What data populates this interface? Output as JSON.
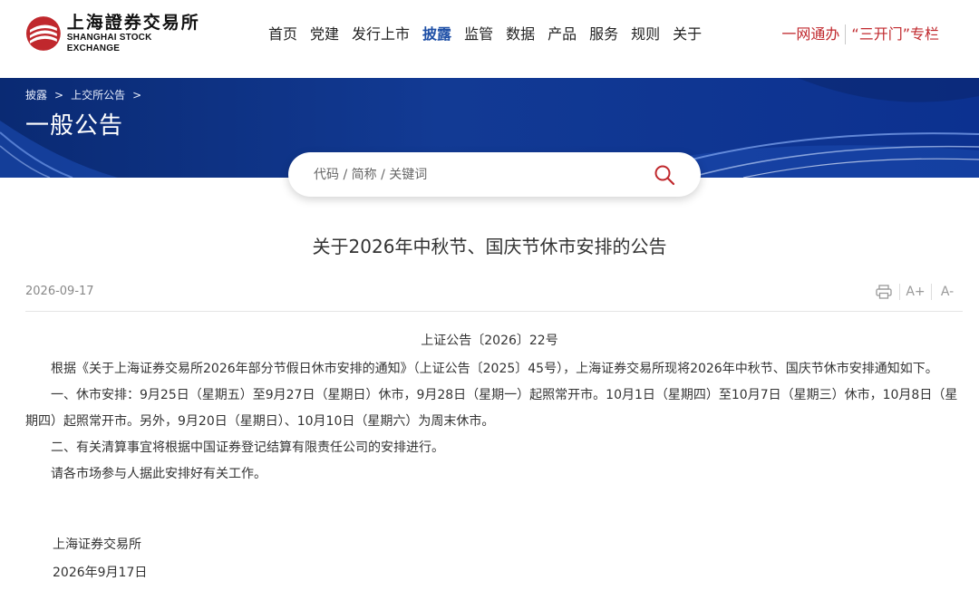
{
  "header": {
    "logo_cn": "上海證券交易所",
    "logo_en": "SHANGHAI STOCK EXCHANGE",
    "nav": [
      "首页",
      "党建",
      "发行上市",
      "披露",
      "监管",
      "数据",
      "产品",
      "服务",
      "规则",
      "关于"
    ],
    "active_nav": "披露",
    "links": [
      "一网通办",
      "“三开门”专栏"
    ],
    "accent_color": "#c0282d"
  },
  "banner": {
    "breadcrumb": [
      "披露",
      "上交所公告"
    ],
    "title": "一般公告"
  },
  "search": {
    "placeholder": "代码 / 简称 / 关键词"
  },
  "article": {
    "title": "关于2026年中秋节、国庆节休市安排的公告",
    "date": "2026-09-17",
    "tools": {
      "print": "print-icon",
      "font_up": "A+",
      "font_down": "A-"
    },
    "doc_number": "上证公告〔2026〕22号",
    "paragraphs": [
      "根据《关于上海证券交易所2026年部分节假日休市安排的通知》（上证公告〔2025〕45号），上海证券交易所现将2026年中秋节、国庆节休市安排通知如下。",
      "一、休市安排：9月25日（星期五）至9月27日（星期日）休市，9月28日（星期一）起照常开市。10月1日（星期四）至10月7日（星期三）休市，10月8日（星期四）起照常开市。另外，9月20日（星期日）、10月10日（星期六）为周末休市。",
      "二、有关清算事宜将根据中国证券登记结算有限责任公司的安排进行。",
      "请各市场参与人据此安排好有关工作。"
    ],
    "signature": "上海证券交易所",
    "sign_date": "2026年9月17日"
  }
}
